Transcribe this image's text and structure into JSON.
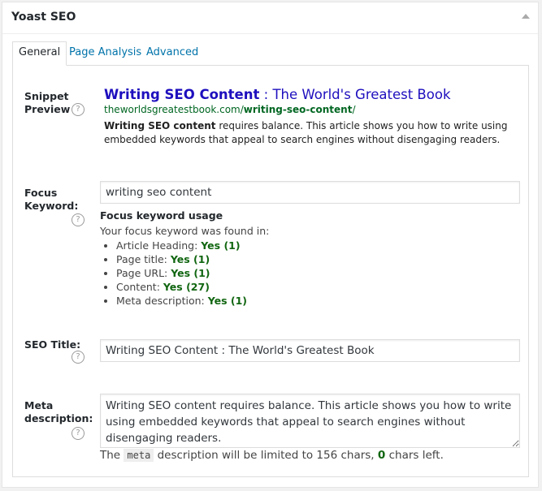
{
  "panel": {
    "title": "Yoast SEO"
  },
  "tabs": [
    "General",
    "Page Analysis",
    "Advanced"
  ],
  "snippet": {
    "label_line1": "Snippet",
    "label_line2": "Preview",
    "title_keyword": "Writing SEO Content",
    "title_rest": " : The World's Greatest Book",
    "url_plain": "theworldsgreatestbook.com/",
    "url_bold": "writing-seo-content",
    "url_tail": "/",
    "desc_bold": "Writing SEO content",
    "desc_rest": " requires balance. This article shows you how to write using embedded keywords that appeal to search engines without disengaging readers."
  },
  "focus": {
    "label_line1": "Focus",
    "label_line2": "Keyword:",
    "value": "writing seo content",
    "usage_heading": "Focus keyword usage",
    "usage_intro": "Your focus keyword was found in:",
    "items": [
      {
        "label": "Article Heading: ",
        "result": "Yes (1)"
      },
      {
        "label": "Page title: ",
        "result": "Yes (1)"
      },
      {
        "label": "Page URL: ",
        "result": "Yes (1)"
      },
      {
        "label": "Content: ",
        "result": "Yes (27)"
      },
      {
        "label": "Meta description: ",
        "result": "Yes (1)"
      }
    ]
  },
  "seo_title": {
    "label": "SEO Title:",
    "value": "Writing SEO Content : The World's Greatest Book"
  },
  "meta": {
    "label_line1": "Meta",
    "label_line2": "description:",
    "value": "Writing SEO content requires balance. This article shows you how to write using embedded keywords that appeal to search engines without disengaging readers.",
    "note_pre": "The ",
    "note_code": "meta",
    "note_mid": " description will be limited to 156 chars, ",
    "note_count": "0",
    "note_post": " chars left."
  },
  "help_glyph": "?",
  "icons": {
    "help": "help-circle-icon",
    "toggle": "triangle-up-icon"
  }
}
